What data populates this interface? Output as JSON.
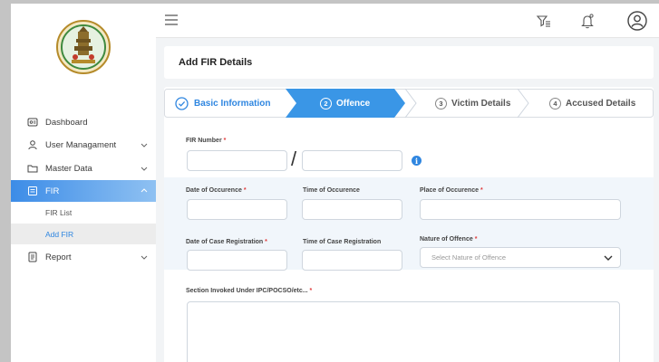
{
  "sidebar": {
    "logo_icon": "tamil-nadu-emblem-icon",
    "items": [
      {
        "label": "Dashboard",
        "icon": "dashboard-icon"
      },
      {
        "label": "User Managament",
        "icon": "user-icon"
      },
      {
        "label": "Master Data",
        "icon": "folder-icon"
      },
      {
        "label": "FIR",
        "icon": "fir-icon"
      },
      {
        "label": "Report",
        "icon": "report-icon"
      }
    ],
    "fir_sub": [
      "FIR List",
      "Add FIR"
    ]
  },
  "topbar": {
    "icons": [
      "menu-icon",
      "filter-list-icon",
      "notification-bell-icon",
      "user-avatar-icon"
    ]
  },
  "page": {
    "title": "Add FIR Details"
  },
  "stepper": {
    "steps": [
      {
        "num": "",
        "label": "Basic Information",
        "state": "done"
      },
      {
        "num": "2",
        "label": "Offence",
        "state": "active"
      },
      {
        "num": "3",
        "label": "Victim Details",
        "state": "pending"
      },
      {
        "num": "4",
        "label": "Accused Details",
        "state": "pending"
      }
    ]
  },
  "form": {
    "fir_number_label": "FIR Number",
    "slash": "/",
    "date_occurence_label": "Date of Occurence",
    "time_occurence_label": "Time of Occurence",
    "place_occurence_label": "Place of Occurence",
    "date_registration_label": "Date of Case Registration",
    "time_registration_label": "Time of Case Registration",
    "nature_offence_label": "Nature of Offence",
    "nature_offence_placeholder": "Select Nature of Offence",
    "section_label": "Section Invoked Under IPC/POCSO/etc...",
    "required_mark": "*",
    "info_glyph": "i"
  },
  "colors": {
    "accent": "#2f86e0",
    "required": "#e03b3b"
  }
}
